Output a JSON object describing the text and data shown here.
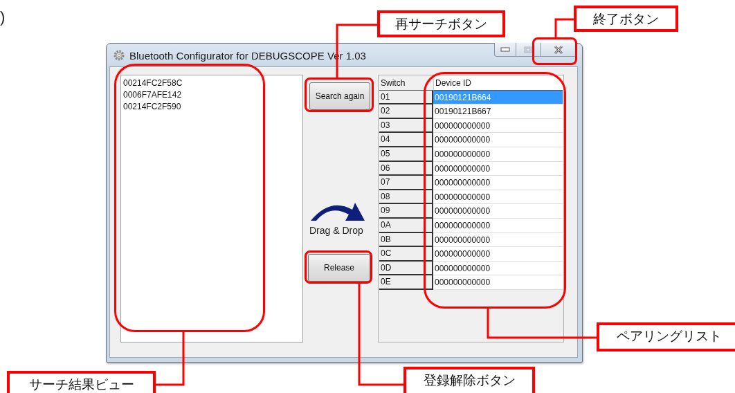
{
  "page_fragment": ")",
  "window": {
    "title": "Bluetooth Configurator for DEBUGSCOPE Ver 1.03"
  },
  "search_results": [
    "00214FC2F58C",
    "0006F7AFE142",
    "00214FC2F590"
  ],
  "buttons": {
    "search": "Search again",
    "release": "Release"
  },
  "drag_hint": "Drag & Drop",
  "pairing_table": {
    "columns": [
      "Switch",
      "Device ID"
    ],
    "rows": [
      {
        "switch": "01",
        "device_id": "00190121B664",
        "selected": true
      },
      {
        "switch": "02",
        "device_id": "00190121B667",
        "selected": false
      },
      {
        "switch": "03",
        "device_id": "000000000000",
        "selected": false
      },
      {
        "switch": "04",
        "device_id": "000000000000",
        "selected": false
      },
      {
        "switch": "05",
        "device_id": "000000000000",
        "selected": false
      },
      {
        "switch": "06",
        "device_id": "000000000000",
        "selected": false
      },
      {
        "switch": "07",
        "device_id": "000000000000",
        "selected": false
      },
      {
        "switch": "08",
        "device_id": "000000000000",
        "selected": false
      },
      {
        "switch": "09",
        "device_id": "000000000000",
        "selected": false
      },
      {
        "switch": "0A",
        "device_id": "000000000000",
        "selected": false
      },
      {
        "switch": "0B",
        "device_id": "000000000000",
        "selected": false
      },
      {
        "switch": "0C",
        "device_id": "000000000000",
        "selected": false
      },
      {
        "switch": "0D",
        "device_id": "000000000000",
        "selected": false
      },
      {
        "switch": "0E",
        "device_id": "000000000000",
        "selected": false
      }
    ]
  },
  "callouts": [
    {
      "label": "終了ボタン"
    },
    {
      "label": "再サーチボタン"
    },
    {
      "label": "ペアリングリスト"
    },
    {
      "label": "サーチ結果ビュー"
    },
    {
      "label": "登録解除ボタン"
    }
  ]
}
